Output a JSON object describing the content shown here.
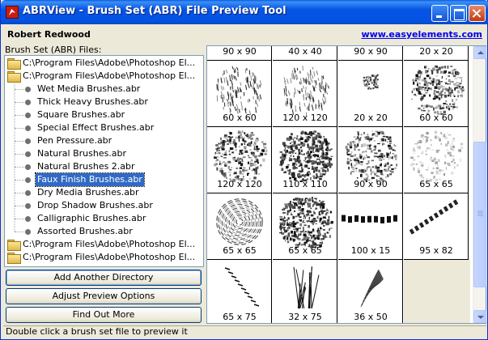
{
  "window": {
    "title": "ABRView - Brush Set (ABR) File Preview Tool"
  },
  "header": {
    "author": "Robert Redwood",
    "website": "www.easyelements.com"
  },
  "files_label": "Brush Set (ABR) Files:",
  "tree": {
    "rows": [
      {
        "kind": "folder",
        "label": "C:\\Program Files\\Adobe\\Photoshop El..."
      },
      {
        "kind": "folder",
        "label": "C:\\Program Files\\Adobe\\Photoshop El..."
      },
      {
        "kind": "file",
        "label": "Wet Media Brushes.abr"
      },
      {
        "kind": "file",
        "label": "Thick Heavy Brushes.abr"
      },
      {
        "kind": "file",
        "label": "Square Brushes.abr"
      },
      {
        "kind": "file",
        "label": "Special Effect Brushes.abr"
      },
      {
        "kind": "file",
        "label": "Pen Pressure.abr"
      },
      {
        "kind": "file",
        "label": "Natural Brushes.abr"
      },
      {
        "kind": "file",
        "label": "Natural Brushes 2.abr"
      },
      {
        "kind": "file",
        "label": "Faux Finish Brushes.abr",
        "selected": true
      },
      {
        "kind": "file",
        "label": "Dry Media Brushes.abr"
      },
      {
        "kind": "file",
        "label": "Drop Shadow Brushes.abr"
      },
      {
        "kind": "file",
        "label": "Calligraphic Brushes.abr"
      },
      {
        "kind": "file",
        "label": "Assorted Brushes.abr"
      },
      {
        "kind": "folder",
        "label": "C:\\Program Files\\Adobe\\Photoshop El..."
      },
      {
        "kind": "folder",
        "label": "C:\\Program Files\\Adobe\\Photoshop El..."
      }
    ]
  },
  "buttons": {
    "add_directory": "Add Another Directory",
    "adjust_preview": "Adjust Preview Options",
    "find_out_more": "Find Out More"
  },
  "status": "Double click a brush set file to preview it",
  "brushes": [
    {
      "size": "90 x 90",
      "texture": "none"
    },
    {
      "size": "40 x 40",
      "texture": "none"
    },
    {
      "size": "90 x 90",
      "texture": "none"
    },
    {
      "size": "20 x 20",
      "texture": "none"
    },
    {
      "size": "60 x 60",
      "texture": "scratchy"
    },
    {
      "size": "120 x 120",
      "texture": "scratchy"
    },
    {
      "size": "20 x 20",
      "texture": "small-square"
    },
    {
      "size": "60 x 60",
      "texture": "noisy"
    },
    {
      "size": "120 x 120",
      "texture": "noisy"
    },
    {
      "size": "110 x 110",
      "texture": "dark-noisy"
    },
    {
      "size": "90 x 90",
      "texture": "noisy"
    },
    {
      "size": "65 x 65",
      "texture": "light-noisy"
    },
    {
      "size": "65 x 65",
      "texture": "swirl"
    },
    {
      "size": "65 x 65",
      "texture": "dark-noisy"
    },
    {
      "size": "100 x 15",
      "texture": "bristle-row"
    },
    {
      "size": "95 x 82",
      "texture": "bristle-diag"
    },
    {
      "size": "65 x 75",
      "texture": "dash-diag"
    },
    {
      "size": "32 x 75",
      "texture": "grass"
    },
    {
      "size": "36 x 50",
      "texture": "feather"
    }
  ],
  "icons": {
    "app": "abrview-app-icon",
    "minimize": "minimize-icon",
    "maximize": "maximize-icon",
    "close": "close-icon",
    "folder": "folder-icon",
    "file_bullet": "bullet-icon",
    "scroll_up": "scroll-up-arrow-icon",
    "scroll_down": "scroll-down-arrow-icon"
  },
  "colors": {
    "titlebar": "#0554e4",
    "selection": "#316ac5",
    "link": "#0000ee",
    "face": "#ece9d8"
  }
}
